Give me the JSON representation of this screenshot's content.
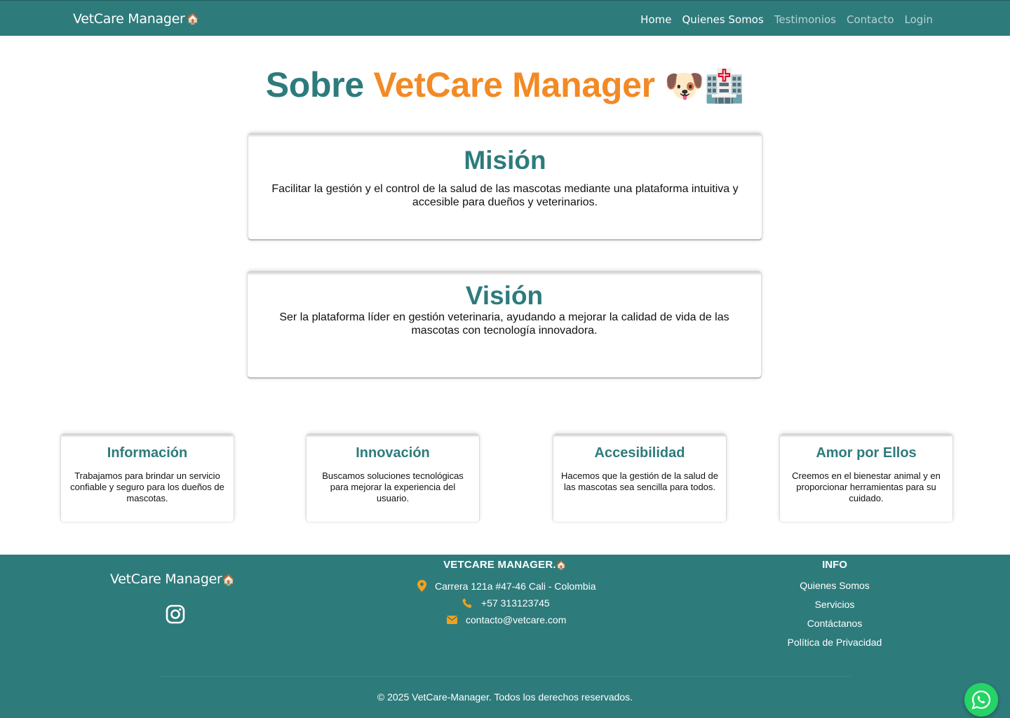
{
  "navbar": {
    "brand": "VetCare Manager",
    "brand_emoji": "🏠",
    "links": [
      {
        "label": "Home",
        "active": true
      },
      {
        "label": "Quienes Somos",
        "active": true
      },
      {
        "label": "Testimonios",
        "active": false
      },
      {
        "label": "Contacto",
        "active": false
      },
      {
        "label": "Login",
        "active": false
      }
    ]
  },
  "hero": {
    "title_prefix": "Sobre",
    "title_highlight": "VetCare Manager",
    "title_emojis": "🐶🏥"
  },
  "mission": {
    "title": "Misión",
    "text": "Facilitar la gestión y el control de la salud de las mascotas mediante una plataforma intuitiva y accesible para dueños y veterinarios."
  },
  "vision": {
    "title": "Visión",
    "text": "Ser la plataforma líder en gestión veterinaria, ayudando a mejorar la calidad de vida de las mascotas con tecnología innovadora."
  },
  "values": [
    {
      "title": "Información",
      "text": "Trabajamos para brindar un servicio confiable y seguro para los dueños de mascotas."
    },
    {
      "title": "Innovación",
      "text": "Buscamos soluciones tecnológicas para mejorar la experiencia del usuario."
    },
    {
      "title": "Accesibilidad",
      "text": "Hacemos que la gestión de la salud de las mascotas sea sencilla para todos."
    },
    {
      "title": "Amor por Ellos",
      "text": "Creemos en el bienestar animal y en proporcionar herramientas para su cuidado."
    }
  ],
  "footer": {
    "brand": "VetCare Manager",
    "brand_emoji": "🏠",
    "center_title": "VETCARE MANAGER.",
    "address": "Carrera 121a #47-46 Cali - Colombia",
    "phone": "+57 313123745",
    "email": "contacto@vetcare.com",
    "info_title": "INFO",
    "info_links": [
      "Quienes Somos",
      "Servicios",
      "Contáctanos",
      "Política de Privacidad"
    ],
    "copyright": "© 2025 VetCare-Manager. Todos los derechos reservados."
  },
  "colors": {
    "primary": "#2e7b7c",
    "accent": "#f28a25",
    "whatsapp": "#25d366"
  },
  "icons": [
    "location-icon",
    "phone-icon",
    "email-icon",
    "instagram-icon",
    "whatsapp-icon"
  ]
}
